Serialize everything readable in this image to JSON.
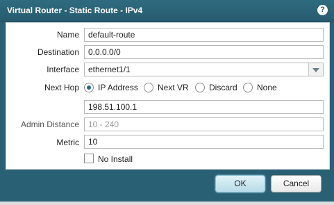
{
  "dialog": {
    "title": "Virtual Router - Static Route - IPv4",
    "help_icon": "?"
  },
  "form": {
    "name": {
      "label": "Name",
      "value": "default-route"
    },
    "destination": {
      "label": "Destination",
      "value": "0.0.0.0/0"
    },
    "interface": {
      "label": "Interface",
      "value": "ethernet1/1"
    },
    "next_hop": {
      "label": "Next Hop",
      "options": [
        "IP Address",
        "Next VR",
        "Discard",
        "None"
      ],
      "selected": "IP Address",
      "ip_value": "198.51.100.1"
    },
    "admin_distance": {
      "label": "Admin Distance",
      "placeholder": "10 - 240"
    },
    "metric": {
      "label": "Metric",
      "value": "10"
    },
    "no_install": {
      "label": "No Install",
      "checked": false
    }
  },
  "buttons": {
    "ok": "OK",
    "cancel": "Cancel"
  },
  "colors": {
    "titlebar": "#2a6074",
    "radio_selected": "#2a6a82"
  }
}
